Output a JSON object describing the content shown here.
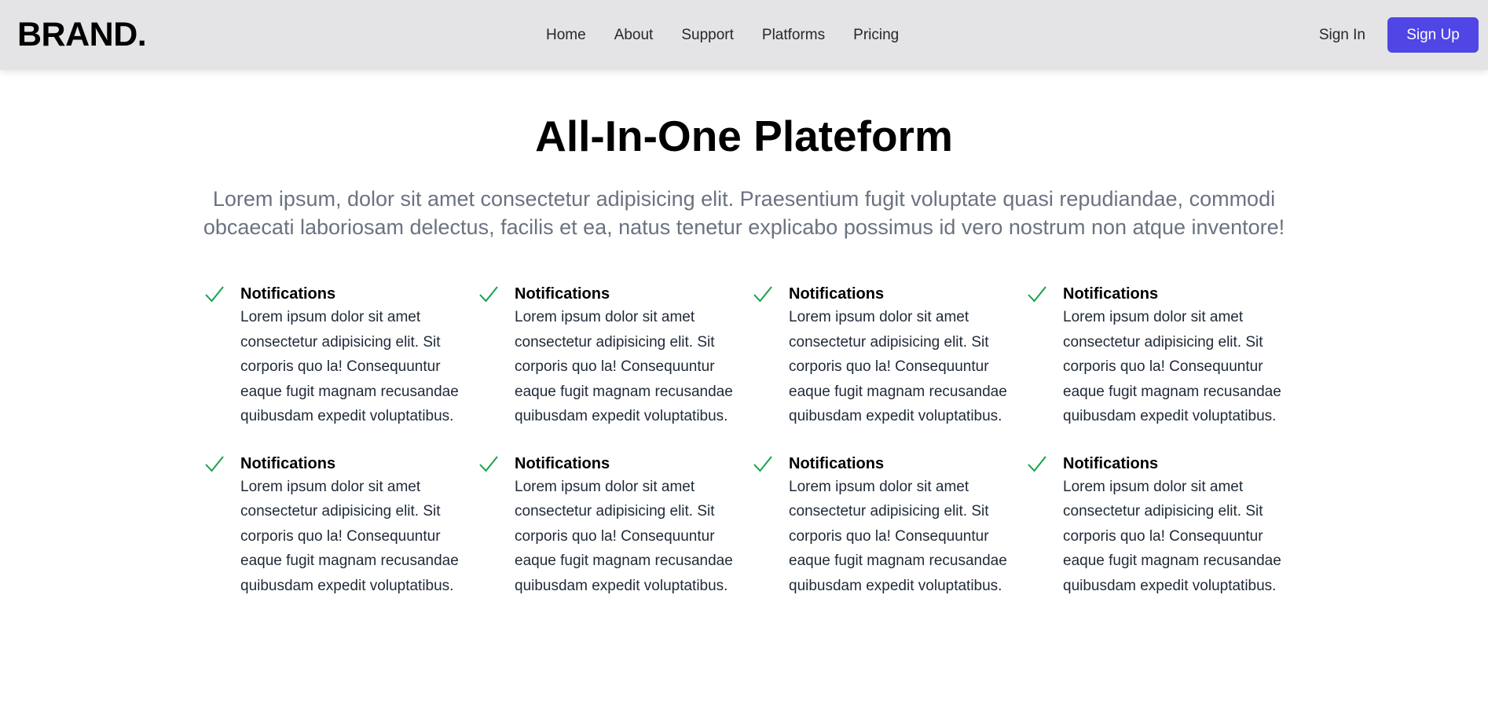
{
  "nav": {
    "brand": "BRAND.",
    "links": [
      "Home",
      "About",
      "Support",
      "Platforms",
      "Pricing"
    ],
    "sign_in": "Sign In",
    "sign_up": "Sign Up"
  },
  "colors": {
    "accent": "#4f46e5",
    "check": "#16a34a",
    "nav_bg": "#e4e4e7"
  },
  "hero": {
    "title": "All-In-One Plateform",
    "subtitle": "Lorem ipsum, dolor sit amet consectetur adipisicing elit. Praesentium fugit voluptate quasi repudiandae, commodi obcaecati laboriosam delectus, facilis et ea, natus tenetur explicabo possimus id vero nostrum non atque inventore!"
  },
  "features": [
    {
      "icon": "check-icon",
      "title": "Notifications",
      "description": "Lorem ipsum dolor sit amet consectetur adipisicing elit. Sit corporis quo la! Consequuntur eaque fugit magnam recusandae quibusdam expedit voluptatibus."
    },
    {
      "icon": "check-icon",
      "title": "Notifications",
      "description": "Lorem ipsum dolor sit amet consectetur adipisicing elit. Sit corporis quo la! Consequuntur eaque fugit magnam recusandae quibusdam expedit voluptatibus."
    },
    {
      "icon": "check-icon",
      "title": "Notifications",
      "description": "Lorem ipsum dolor sit amet consectetur adipisicing elit. Sit corporis quo la! Consequuntur eaque fugit magnam recusandae quibusdam expedit voluptatibus."
    },
    {
      "icon": "check-icon",
      "title": "Notifications",
      "description": "Lorem ipsum dolor sit amet consectetur adipisicing elit. Sit corporis quo la! Consequuntur eaque fugit magnam recusandae quibusdam expedit voluptatibus."
    },
    {
      "icon": "check-icon",
      "title": "Notifications",
      "description": "Lorem ipsum dolor sit amet consectetur adipisicing elit. Sit corporis quo la! Consequuntur eaque fugit magnam recusandae quibusdam expedit voluptatibus."
    },
    {
      "icon": "check-icon",
      "title": "Notifications",
      "description": "Lorem ipsum dolor sit amet consectetur adipisicing elit. Sit corporis quo la! Consequuntur eaque fugit magnam recusandae quibusdam expedit voluptatibus."
    },
    {
      "icon": "check-icon",
      "title": "Notifications",
      "description": "Lorem ipsum dolor sit amet consectetur adipisicing elit. Sit corporis quo la! Consequuntur eaque fugit magnam recusandae quibusdam expedit voluptatibus."
    },
    {
      "icon": "check-icon",
      "title": "Notifications",
      "description": "Lorem ipsum dolor sit amet consectetur adipisicing elit. Sit corporis quo la! Consequuntur eaque fugit magnam recusandae quibusdam expedit voluptatibus."
    }
  ]
}
